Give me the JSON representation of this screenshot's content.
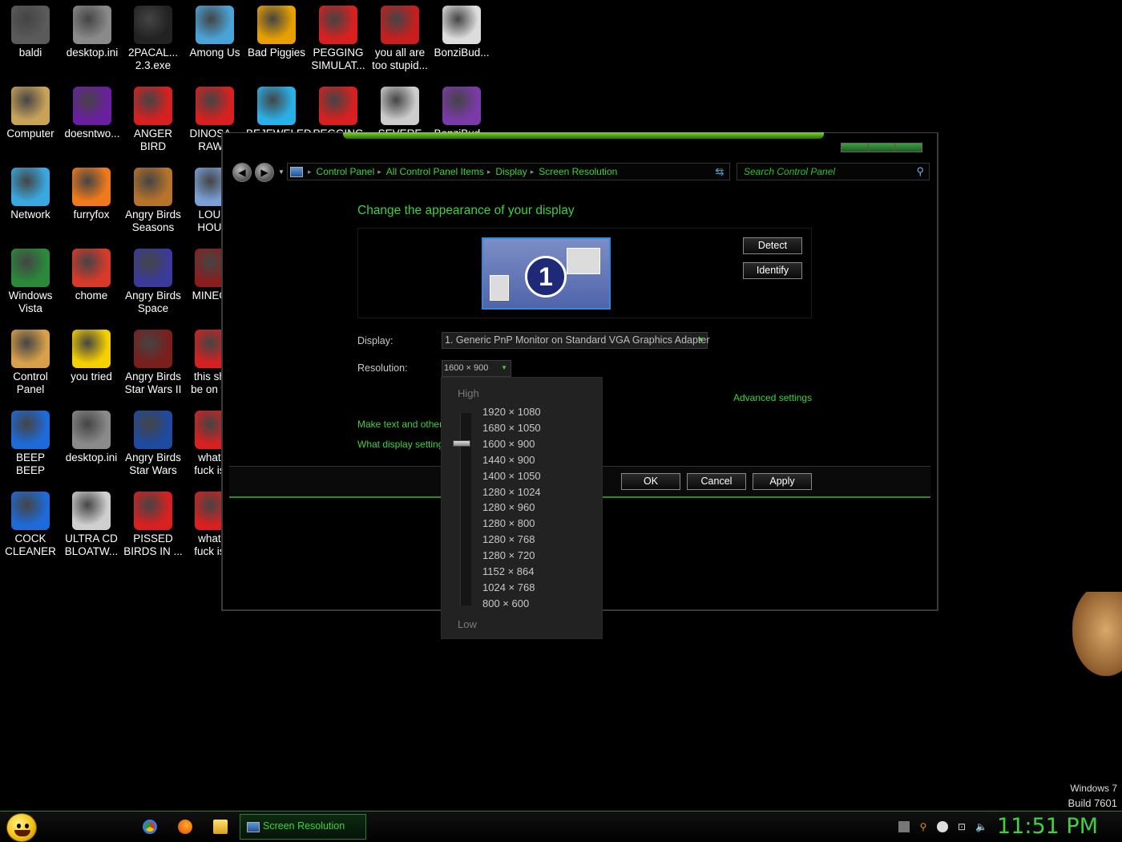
{
  "desktop_icons": [
    {
      "label": "baldi",
      "icon": "baldi-icon",
      "color": "#5a5a5a"
    },
    {
      "label": "desktop.ini",
      "icon": "settings-file-icon",
      "color": "#8a8a8a"
    },
    {
      "label": "2PACAL...\n2.3.exe",
      "icon": "console-icon",
      "color": "#222222"
    },
    {
      "label": "Among Us",
      "icon": "game-icon",
      "color": "#4aa3d8"
    },
    {
      "label": "Bad Piggies",
      "icon": "piggy-icon",
      "color": "#e8a000"
    },
    {
      "label": "PEGGING\nSIMULAT...",
      "icon": "p-logo-icon",
      "color": "#d82020"
    },
    {
      "label": "you all are\ntoo stupid...",
      "icon": "devcpp-icon",
      "color": "#c81e1e"
    },
    {
      "label": "BonziBud...",
      "icon": "shortcut-icon",
      "color": "#dddddd"
    },
    {
      "label": "Computer",
      "icon": "computer-icon",
      "color": "#c9a25a"
    },
    {
      "label": "doesntwo...",
      "icon": "yahoo-icon",
      "color": "#6a1ea0"
    },
    {
      "label": "ANGER\nBIRD",
      "icon": "angry-bird-icon",
      "color": "#d82020"
    },
    {
      "label": "DINOSA...\nRAW...",
      "icon": "angry-bird-icon",
      "color": "#d82020"
    },
    {
      "label": "BEJEWELED",
      "icon": "gem-icon",
      "color": "#2ab0e8"
    },
    {
      "label": "PEGGING",
      "icon": "p-logo-icon",
      "color": "#d82020"
    },
    {
      "label": "SEVERE",
      "icon": "sd-gear-icon",
      "color": "#cccccc"
    },
    {
      "label": "BonziBud...",
      "icon": "bonzi-icon",
      "color": "#7a3aa8"
    },
    {
      "label": "Network",
      "icon": "network-globe-icon",
      "color": "#3aa8e0"
    },
    {
      "label": "furryfox",
      "icon": "firefox-icon",
      "color": "#f07a1a"
    },
    {
      "label": "Angry Birds\nSeasons",
      "icon": "angry-birds-seasons-icon",
      "color": "#b8732a"
    },
    {
      "label": "LOU...\nHOU...",
      "icon": "game-icon",
      "color": "#7aa0d8"
    },
    {
      "label": "Windows\nVista",
      "icon": "recycle-bin-icon",
      "color": "#2a8a3a"
    },
    {
      "label": "chome",
      "icon": "chrome-icon",
      "color": "#d83a2a"
    },
    {
      "label": "Angry Birds\nSpace",
      "icon": "angry-birds-space-icon",
      "color": "#3a3a9a"
    },
    {
      "label": "MINEC...",
      "icon": "minecraft-icon",
      "color": "#8a1e1e"
    },
    {
      "label": "Control\nPanel",
      "icon": "control-panel-icon",
      "color": "#d8a04a"
    },
    {
      "label": "you tried",
      "icon": "star-icon",
      "color": "#f5d000"
    },
    {
      "label": "Angry Birds\nStar Wars II",
      "icon": "angry-birds-starwars-icon",
      "color": "#7a1e1e"
    },
    {
      "label": "this sh...\nbe on w...",
      "icon": "angry-bird-icon",
      "color": "#d82020"
    },
    {
      "label": "BEEP\nBEEP",
      "icon": "blue-panel-icon",
      "color": "#1e6ad8"
    },
    {
      "label": "desktop.ini",
      "icon": "settings-file-icon",
      "color": "#8a8a8a"
    },
    {
      "label": "Angry Birds\nStar Wars",
      "icon": "angry-birds-starwars-icon",
      "color": "#1e4aa0"
    },
    {
      "label": "what...\nfuck is...",
      "icon": "angry-bird-icon",
      "color": "#d82020"
    },
    {
      "label": "COCK\nCLEANER",
      "icon": "blue-panel-icon",
      "color": "#1e6ad8"
    },
    {
      "label": "ULTRA CD\nBLOATW...",
      "icon": "cd-icon",
      "color": "#cfcfcf"
    },
    {
      "label": "PISSED\nBIRDS IN ...",
      "icon": "angry-bird-icon",
      "color": "#d82020"
    },
    {
      "label": "what...\nfuck is...",
      "icon": "angry-bird-icon",
      "color": "#d82020"
    }
  ],
  "window": {
    "breadcrumbs": [
      "Control Panel",
      "All Control Panel Items",
      "Display",
      "Screen Resolution"
    ],
    "search_placeholder": "Search Control Panel",
    "title": "Change the appearance of your display",
    "monitor_number": "1",
    "detect_label": "Detect",
    "identify_label": "Identify",
    "display_label": "Display:",
    "display_value": "1. Generic PnP Monitor on Standard VGA Graphics Adapter",
    "resolution_label": "Resolution:",
    "resolution_value": "1600 × 900",
    "advanced_link": "Advanced settings",
    "text_link": "Make text and other items larger or smaller",
    "what_link": "What display settings should I choose?",
    "ok_label": "OK",
    "cancel_label": "Cancel",
    "apply_label": "Apply"
  },
  "resolution_dropdown": {
    "high_label": "High",
    "low_label": "Low",
    "options": [
      "1920 × 1080",
      "1680 × 1050",
      "1600 × 900",
      "1440 × 900",
      "1400 × 1050",
      "1280 × 1024",
      "1280 × 960",
      "1280 × 800",
      "1280 × 768",
      "1280 × 720",
      "1152 × 864",
      "1024 × 768",
      "800 × 600"
    ],
    "selected": "1600 × 900"
  },
  "watermark": {
    "line1": "Windows 7",
    "line2": "Build 7601"
  },
  "taskbar": {
    "active_task": "Screen Resolution",
    "clock": "11:51 PM",
    "accent": "#3fd13f"
  }
}
